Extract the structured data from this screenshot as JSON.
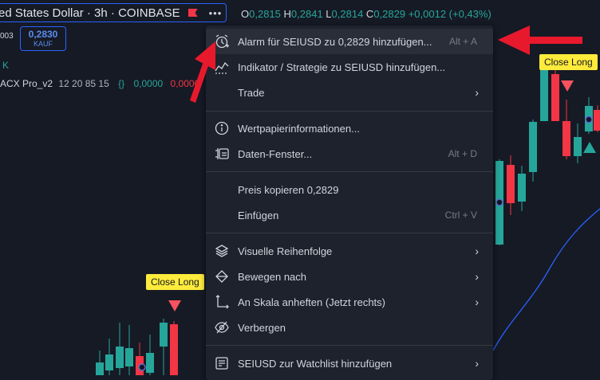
{
  "legend": {
    "title": "ed States Dollar · 3h · COINBASE",
    "more": "•••",
    "ohlc": [
      {
        "k": "O",
        "v": "0,2815"
      },
      {
        "k": "H",
        "v": "0,2841"
      },
      {
        "k": "L",
        "v": "0,2814"
      },
      {
        "k": "C",
        "v": "0,2829"
      }
    ],
    "change": "+0,0012 (+0,43%)",
    "side_value": "003",
    "buy_price": "0,2830",
    "buy_label": "KAUF",
    "k_label": "K",
    "indicator_name": "ACX Pro_v2",
    "indicator_params": "12 20 85 15",
    "indicator_brace": "{}",
    "indicator_val_green": "0,0000",
    "indicator_val_red": "0,0000"
  },
  "signals": [
    {
      "label": "Close Long"
    },
    {
      "label": "Close Long"
    }
  ],
  "menu": {
    "items": [
      {
        "icon": "alarm-clock-icon",
        "label": "Alarm für SEIUSD zu 0,2829 hinzufügen...",
        "shortcut": "Alt + A",
        "hover": true
      },
      {
        "icon": "indicator-icon",
        "label": "Indikator / Strategie zu SEIUSD hinzufügen..."
      },
      {
        "icon": "",
        "label": "Trade",
        "submenu": true
      },
      {
        "icon": "info-icon",
        "label": "Wertpapierinformationen..."
      },
      {
        "icon": "data-window-icon",
        "label": "Daten-Fenster...",
        "shortcut": "Alt + D"
      },
      {
        "icon": "",
        "label": "Preis kopieren 0,2829"
      },
      {
        "icon": "",
        "label": "Einfügen",
        "shortcut": "Ctrl + V"
      },
      {
        "icon": "layers-icon",
        "label": "Visuelle Reihenfolge",
        "submenu": true
      },
      {
        "icon": "move-icon",
        "label": "Bewegen nach",
        "submenu": true
      },
      {
        "icon": "scale-pin-icon",
        "label": "An Skala anheften (Jetzt rechts)",
        "submenu": true
      },
      {
        "icon": "eye-off-icon",
        "label": "Verbergen"
      },
      {
        "icon": "watchlist-add-icon",
        "label": "SEIUSD zur Watchlist hinzufügen",
        "submenu": true
      }
    ]
  },
  "colors": {
    "background": "#161a25",
    "up": "#26a69a",
    "down": "#f23645",
    "accent": "#2962ff",
    "annotation_arrow": "#e8192c",
    "signal_tag": "#ffeb3b"
  }
}
